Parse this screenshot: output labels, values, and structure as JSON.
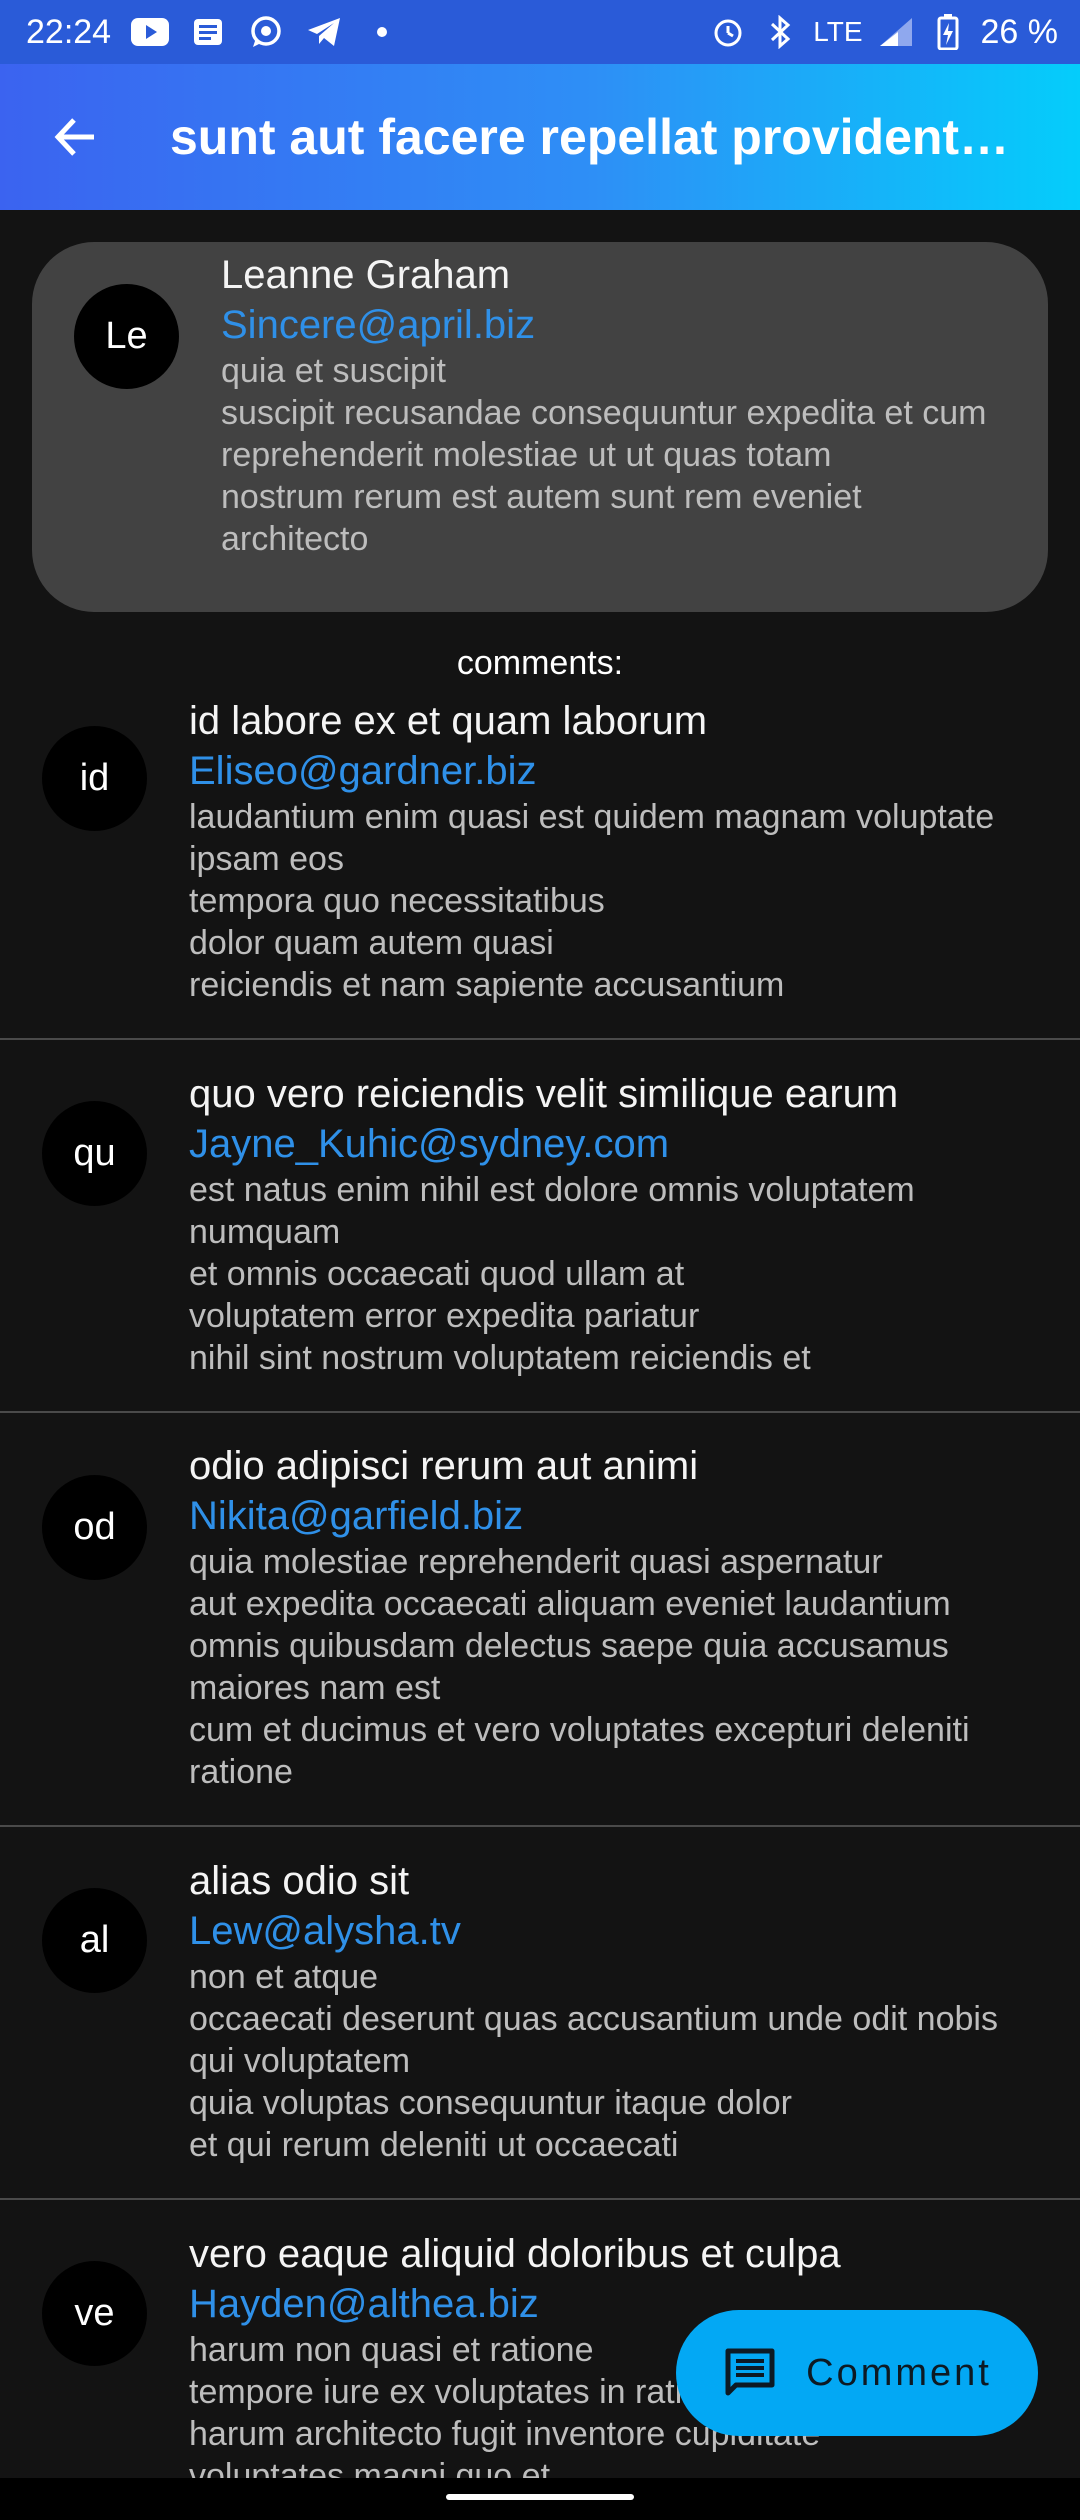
{
  "status_bar": {
    "time": "22:24",
    "network": "LTE",
    "battery": "26 %",
    "icons": [
      "youtube-icon",
      "news-icon",
      "whatsapp-icon",
      "telegram-icon",
      "dot-icon",
      "alarm-icon",
      "bluetooth-icon",
      "signal-icon",
      "battery-icon"
    ]
  },
  "app_bar": {
    "title": "sunt aut facere repellat provident occaecati excepturi optio reprehenderit",
    "back_icon": "arrow-left-icon",
    "gradient": [
      "#3b63f0",
      "#04cdfb"
    ]
  },
  "post": {
    "avatar": "Le",
    "name": "Leanne Graham",
    "email": "Sincere@april.biz",
    "body": "quia et suscipit\nsuscipit recusandae consequuntur expedita et cum\nreprehenderit molestiae ut ut quas totam\nnostrum rerum est autem sunt rem eveniet architecto"
  },
  "comments_label": "comments:",
  "comments": [
    {
      "avatar": "id",
      "name": "id labore ex et quam laborum",
      "email": "Eliseo@gardner.biz",
      "body": "laudantium enim quasi est quidem magnam voluptate ipsam eos\ntempora quo necessitatibus\ndolor quam autem quasi\nreiciendis et nam sapiente accusantium"
    },
    {
      "avatar": "qu",
      "name": "quo vero reiciendis velit similique earum",
      "email": "Jayne_Kuhic@sydney.com",
      "body": "est natus enim nihil est dolore omnis voluptatem numquam\net omnis occaecati quod ullam at\nvoluptatem error expedita pariatur\nnihil sint nostrum voluptatem reiciendis et"
    },
    {
      "avatar": "od",
      "name": "odio adipisci rerum aut animi",
      "email": "Nikita@garfield.biz",
      "body": "quia molestiae reprehenderit quasi aspernatur\naut expedita occaecati aliquam eveniet laudantium\nomnis quibusdam delectus saepe quia accusamus maiores nam est\ncum et ducimus et vero voluptates excepturi deleniti ratione"
    },
    {
      "avatar": "al",
      "name": "alias odio sit",
      "email": "Lew@alysha.tv",
      "body": "non et atque\noccaecati deserunt quas accusantium unde odit nobis qui voluptatem\nquia voluptas consequuntur itaque dolor\net qui rerum deleniti ut occaecati"
    },
    {
      "avatar": "ve",
      "name": "vero eaque aliquid doloribus et culpa",
      "email": "Hayden@althea.biz",
      "body": "harum non quasi et ratione\ntempore iure ex voluptates in ratione\nharum architecto fugit inventore cupiditate\nvoluptates magni quo et"
    }
  ],
  "fab": {
    "label": "Comment",
    "icon": "comment-icon",
    "color": "#03a8f4"
  },
  "colors": {
    "background": "#131313",
    "card": "#424242",
    "email": "#2f90e8"
  }
}
